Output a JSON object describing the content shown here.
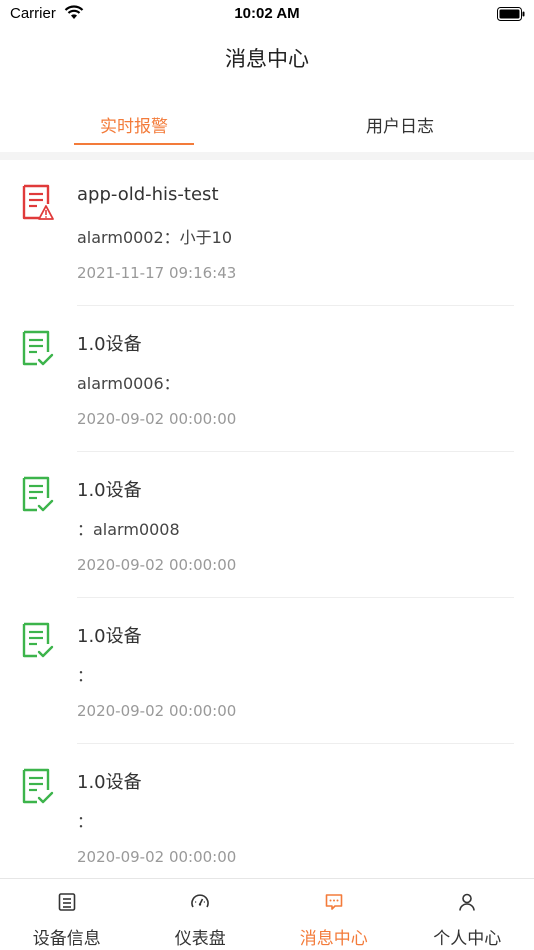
{
  "status_bar": {
    "carrier": "Carrier",
    "time": "10:02 AM"
  },
  "nav": {
    "title": "消息中心"
  },
  "tabs": [
    {
      "label": "实时报警",
      "active": true
    },
    {
      "label": "用户日志",
      "active": false
    }
  ],
  "messages": [
    {
      "icon": "alarm-doc-icon",
      "title": "app-old-his-test",
      "desc": "alarm0002：小于10",
      "time": "2021-11-17 09:16:43"
    },
    {
      "icon": "check-doc-icon",
      "title": "1.0设备",
      "desc": "alarm0006：",
      "time": "2020-09-02 00:00:00"
    },
    {
      "icon": "check-doc-icon",
      "title": "1.0设备",
      "desc": "：alarm0008",
      "time": "2020-09-02 00:00:00"
    },
    {
      "icon": "check-doc-icon",
      "title": "1.0设备",
      "desc": "：",
      "time": "2020-09-02 00:00:00"
    },
    {
      "icon": "check-doc-icon",
      "title": "1.0设备",
      "desc": "：",
      "time": "2020-09-02 00:00:00"
    }
  ],
  "tabbar": [
    {
      "label": "设备信息",
      "icon": "device-info-icon",
      "active": false
    },
    {
      "label": "仪表盘",
      "icon": "dashboard-icon",
      "active": false
    },
    {
      "label": "消息中心",
      "icon": "message-icon",
      "active": true
    },
    {
      "label": "个人中心",
      "icon": "person-icon",
      "active": false
    }
  ],
  "colors": {
    "accent": "#f37b3a",
    "alarm_red": "#e03a3a",
    "ok_green": "#3cb44b"
  }
}
